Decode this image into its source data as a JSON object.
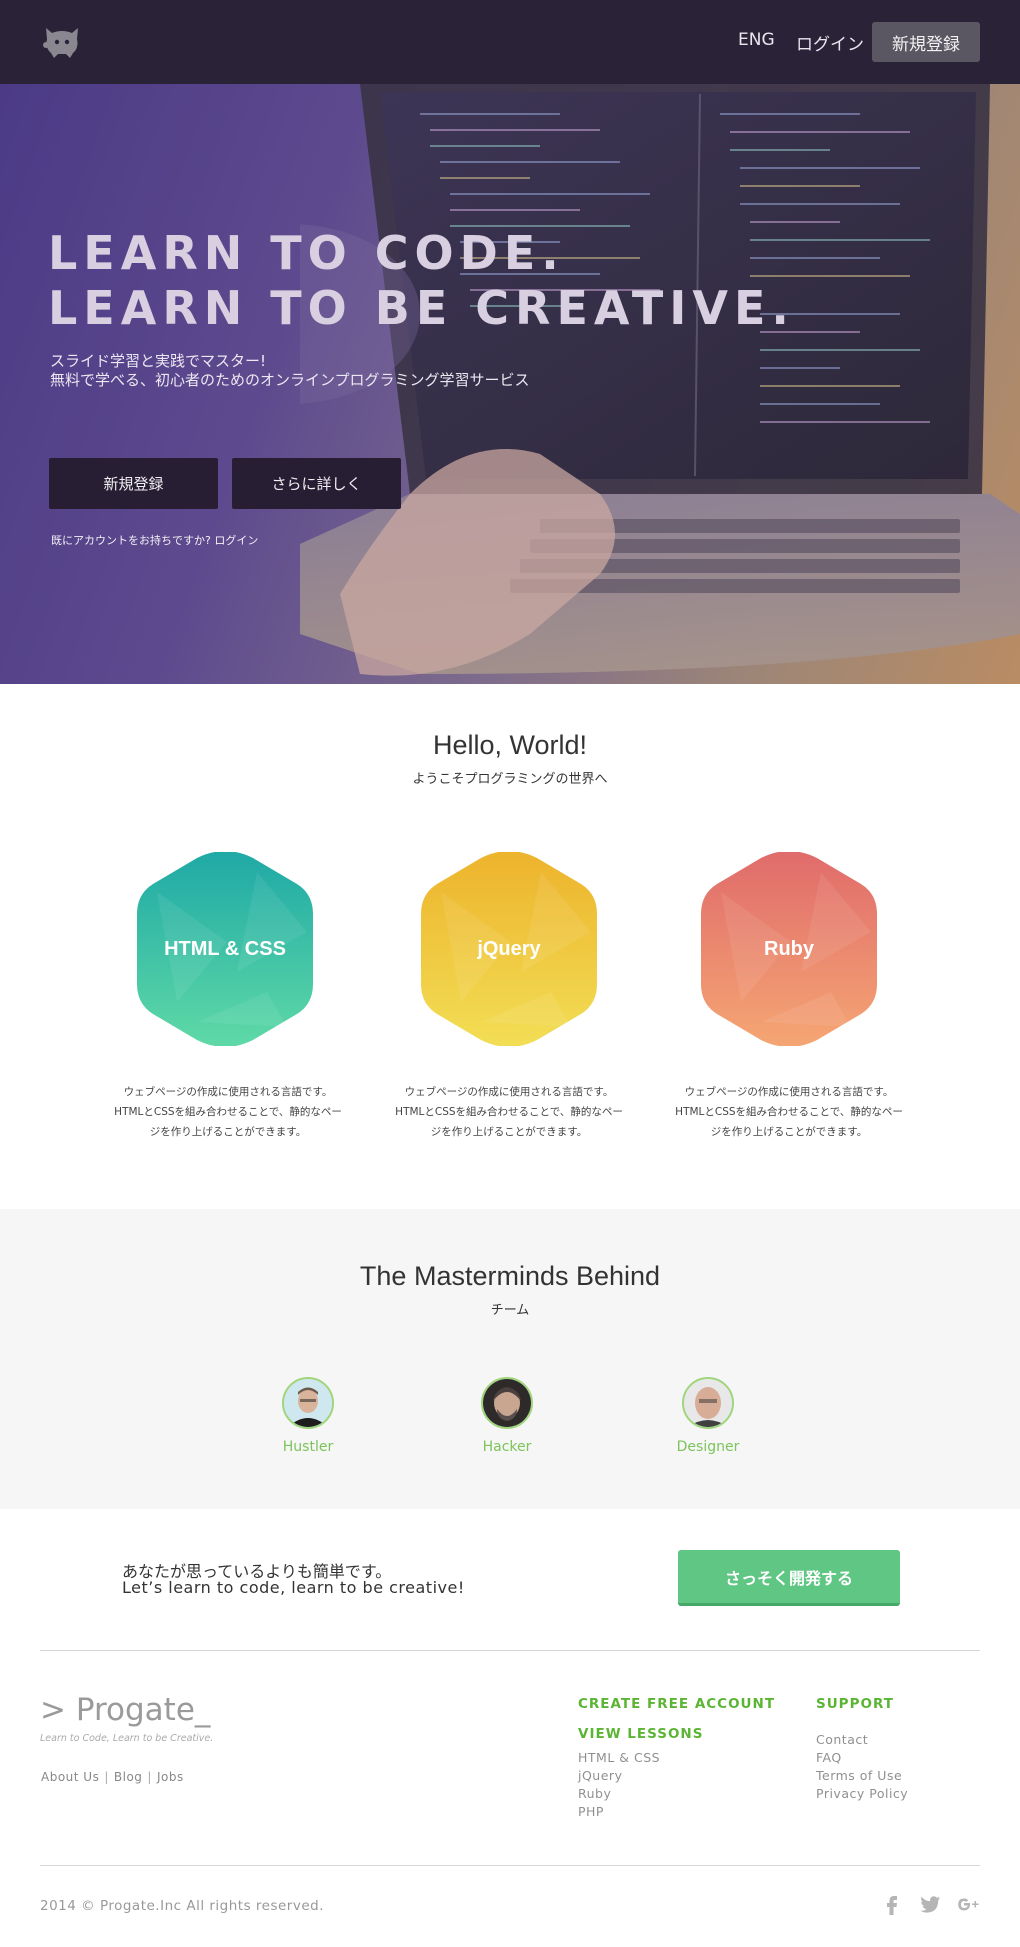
{
  "header": {
    "lang_label": "ENG",
    "login_label": "ログイン",
    "signup_label": "新規登録"
  },
  "hero": {
    "title_line1": "LEARN TO CODE.",
    "title_line2": "LEARN TO BE CREATIVE.",
    "subtitle_line1": "スライド学習と実践でマスター!",
    "subtitle_line2": "無料で学べる、初心者のためのオンラインプログラミング学習サービス",
    "signup_button": "新規登録",
    "more_button": "さらに詳しく",
    "existing_account": "既にアカウントをお持ちですか? ログイン"
  },
  "intro": {
    "title": "Hello, World!",
    "subtitle": "ようこそプログラミングの世界へ",
    "courses": [
      {
        "name": "HTML & CSS",
        "desc_line1": "ウェブページの作成に使用される言語です。",
        "desc_line2": "HTMLとCSSを組み合わせることで、静的なペー",
        "desc_line3": "ジを作り上げることができます。",
        "color_top": "#1fa9a6",
        "color_bottom": "#5fd9a6"
      },
      {
        "name": "jQuery",
        "desc_line1": "ウェブページの作成に使用される言語です。",
        "desc_line2": "HTMLとCSSを組み合わせることで、静的なペー",
        "desc_line3": "ジを作り上げることができます。",
        "color_top": "#edb32c",
        "color_bottom": "#f2de55"
      },
      {
        "name": "Ruby",
        "desc_line1": "ウェブページの作成に使用される言語です。",
        "desc_line2": "HTMLとCSSを組み合わせることで、静的なペー",
        "desc_line3": "ジを作り上げることができます。",
        "color_top": "#e06b6b",
        "color_bottom": "#f5a673"
      }
    ]
  },
  "team": {
    "title": "The Masterminds Behind",
    "subtitle": "チーム",
    "members": [
      {
        "role": "Hustler"
      },
      {
        "role": "Hacker"
      },
      {
        "role": "Designer"
      }
    ],
    "role_color": "#7cc35a"
  },
  "cta": {
    "line_jp": "あなたが思っているよりも簡単です。",
    "line_en": "Let’s learn to code, learn to be creative!",
    "button": "さっそく開発する",
    "button_color": "#5fc683"
  },
  "footer": {
    "brand_name": "> Progate_",
    "tagline": "Learn to Code, Learn to be Creative.",
    "links": [
      "About Us",
      "Blog",
      "Jobs"
    ],
    "link_sep": "|",
    "create_account": "CREATE FREE ACCOUNT",
    "view_lessons": "VIEW LESSONS",
    "lessons": [
      "HTML & CSS",
      "jQuery",
      "Ruby",
      "PHP"
    ],
    "support_heading": "SUPPORT",
    "support_links": [
      "Contact",
      "FAQ",
      "Terms of  Use",
      "Privacy Policy"
    ],
    "copyright": "2014 © Progate.Inc All rights reserved.",
    "social_icons": [
      "facebook-icon",
      "twitter-icon",
      "google-plus-icon"
    ],
    "accent": "#5bb534"
  }
}
